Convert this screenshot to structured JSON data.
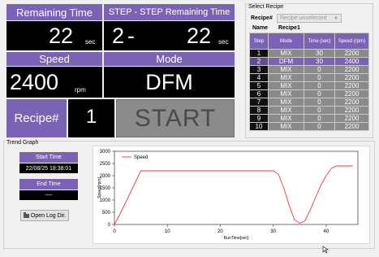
{
  "status": {
    "remaining_time_label": "Remaining Time",
    "remaining_time_value": "22",
    "remaining_time_unit": "sec",
    "step_remaining_label": "STEP - STEP Remaining Time",
    "step_value": "2",
    "step_dash": "-",
    "step_remaining_value": "22",
    "step_remaining_unit": "sec",
    "speed_label": "Speed",
    "speed_value": "2400",
    "speed_unit": "rpm",
    "mode_label": "Mode",
    "mode_value": "DFM",
    "recipe_label": "Recipe#",
    "recipe_value": "1",
    "start_label": "START"
  },
  "select_recipe": {
    "title": "Select Recipe",
    "recipe_field_label": "Recipe#",
    "recipe_dropdown_value": "Recipe unselected",
    "name_label": "Name",
    "name_value": "Recipe1",
    "columns": [
      "Step",
      "Mode",
      "Time (sec)",
      "Speed (rpm)"
    ],
    "rows": [
      {
        "step": "1",
        "mode": "MIX",
        "time": "30",
        "speed": "2200"
      },
      {
        "step": "2",
        "mode": "DFM",
        "time": "30",
        "speed": "2400"
      },
      {
        "step": "3",
        "mode": "MIX",
        "time": "0",
        "speed": "2200"
      },
      {
        "step": "4",
        "mode": "MIX",
        "time": "0",
        "speed": "2200"
      },
      {
        "step": "5",
        "mode": "MIX",
        "time": "0",
        "speed": "2200"
      },
      {
        "step": "6",
        "mode": "MIX",
        "time": "0",
        "speed": "2200"
      },
      {
        "step": "7",
        "mode": "MIX",
        "time": "0",
        "speed": "2200"
      },
      {
        "step": "8",
        "mode": "MIX",
        "time": "0",
        "speed": "2200"
      },
      {
        "step": "9",
        "mode": "MIX",
        "time": "0",
        "speed": "2200"
      },
      {
        "step": "10",
        "mode": "MIX",
        "time": "0",
        "speed": "2200"
      }
    ],
    "selected_row": 1
  },
  "trend": {
    "title": "Trend Graph",
    "start_time_label": "Start Time",
    "start_time_value": "22/08/25 18:38:01",
    "end_time_label": "End Time",
    "end_time_value": "----",
    "open_log_label": "Open Log Dir.",
    "open_log_icon": "folder-icon"
  },
  "chart_data": {
    "type": "line",
    "title": "",
    "xlabel": "RunTime[sec]",
    "ylabel": "Speed[rpm]",
    "xlim": [
      0,
      46
    ],
    "ylim": [
      0,
      3000
    ],
    "xticks": [
      "0",
      "10",
      "20",
      "30",
      "40"
    ],
    "xtick_values": [
      0,
      10,
      20,
      30,
      40
    ],
    "yticks": [
      "0",
      "500",
      "1000",
      "1500",
      "2000",
      "2500",
      "3000"
    ],
    "ytick_values": [
      0,
      500,
      1000,
      1500,
      2000,
      2500,
      3000
    ],
    "grid": false,
    "legend_position": "top-left",
    "series": [
      {
        "name": "Speed",
        "color": "#e8393f",
        "x": [
          0,
          1,
          5,
          10,
          20,
          30,
          31,
          32,
          33,
          34,
          35,
          36,
          37,
          38,
          39,
          40,
          41,
          42,
          44,
          45
        ],
        "y": [
          0,
          400,
          2200,
          2200,
          2200,
          2200,
          2050,
          1500,
          800,
          200,
          50,
          150,
          600,
          1100,
          1600,
          2000,
          2300,
          2400,
          2400,
          2400
        ]
      }
    ]
  },
  "colors": {
    "accent_purple": "#7a63b4",
    "display_black": "#000000",
    "start_gray": "#8b8b8b",
    "series_red": "#e8393f"
  }
}
